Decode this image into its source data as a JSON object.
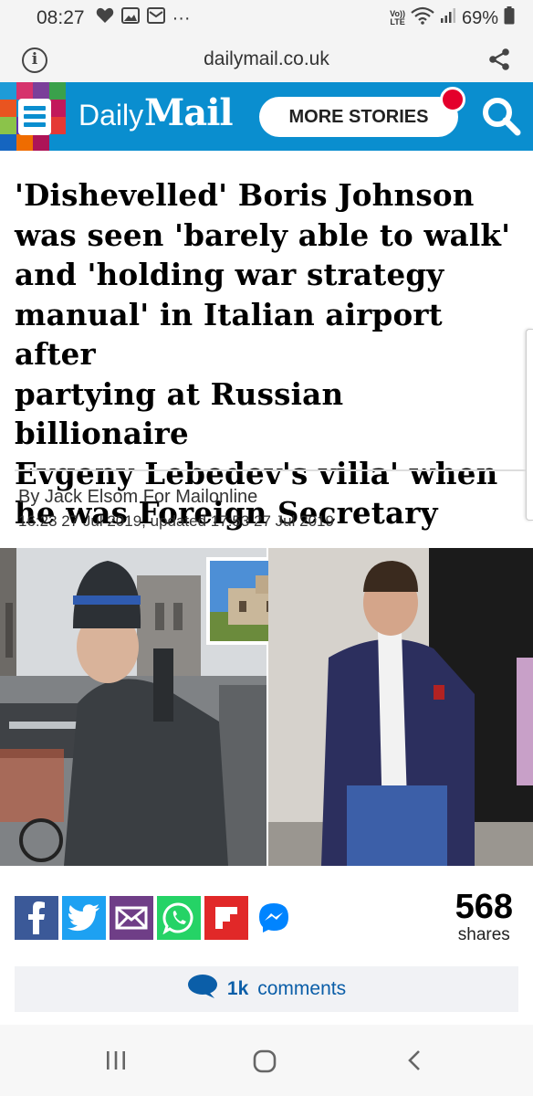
{
  "status_bar": {
    "time": "08:27",
    "dots": "···",
    "lte_top": "Vo))",
    "lte_bottom": "LTE",
    "battery": "69%"
  },
  "browser": {
    "url": "dailymail.co.uk"
  },
  "header": {
    "logo_daily": "Daily",
    "logo_mail": "Mail",
    "more_stories": "MORE STORIES",
    "brand_color": "#0a8ecf"
  },
  "article": {
    "headline_lines": [
      "'Dishevelled' Boris Johnson",
      "was seen 'barely able to walk'",
      "and 'holding war strategy",
      "manual' in Italian airport after",
      "partying at Russian billionaire",
      "Evgeny Lebedev's villa' when",
      "he was Foreign Secretary"
    ],
    "byline": "By Jack Elsom For Mailonline",
    "dateline": "16:23 27 Jul 2019, updated 17:53 27 Jul 2019"
  },
  "share": {
    "buttons": [
      "facebook-icon",
      "twitter-icon",
      "email-icon",
      "whatsapp-icon",
      "flipboard-icon",
      "messenger-icon"
    ],
    "count": "568",
    "count_label": "shares"
  },
  "comments": {
    "count": "1k",
    "label": "comments"
  }
}
